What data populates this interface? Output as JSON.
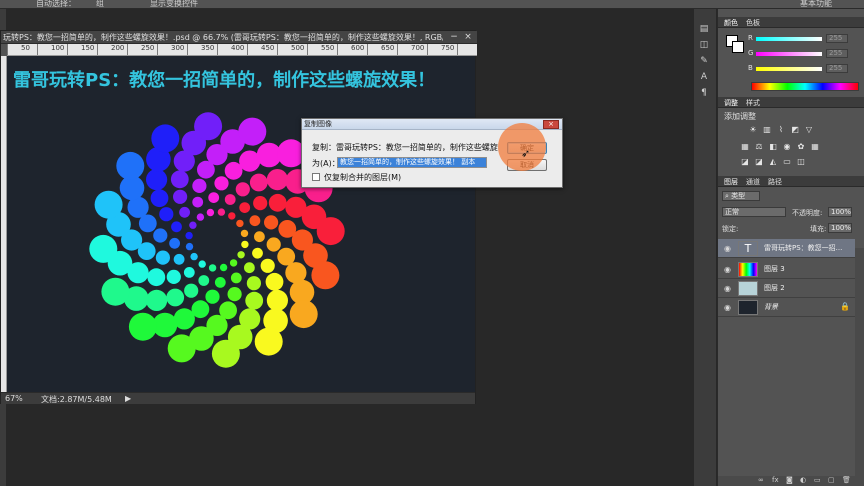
{
  "options_bar": {
    "auto_select": "自动选择：",
    "auto_select_value": "组",
    "show_transform": "显示变换控件",
    "essentials": "基本功能"
  },
  "document": {
    "tab_title": "玩转PS：教您一招简单的，制作这些螺旋效果！.psd @ 66.7% (雷哥玩转PS：教您一招简单的，制作这些螺旋效果！, RGB/...",
    "minimize": "−",
    "close": "×",
    "ruler_marks": [
      "50",
      "100",
      "150",
      "200",
      "250",
      "300",
      "350",
      "400",
      "450",
      "500",
      "550",
      "600",
      "650",
      "700",
      "750"
    ],
    "canvas_title": "雷哥玩转PS：教您一招简单的，制作这些螺旋效果！",
    "zoom": "67%",
    "doc_size": "文档:2.87M/5.48M"
  },
  "dialog": {
    "title": "复制图像",
    "copy_label": "复制：",
    "copy_value": "雷哥玩转PS：教您一招简单的，制作这些螺旋",
    "as_label": "为(A)：",
    "as_value": "教您一招简单的，制作这些螺旋效果！ 副本",
    "merged_checkbox": "仅复制合并的图层(M)",
    "ok": "确定",
    "cancel": "取消",
    "close": "×"
  },
  "color_panel": {
    "tabs": [
      "颜色",
      "色板"
    ],
    "r_label": "R",
    "g_label": "G",
    "b_label": "B",
    "r_value": "255",
    "g_value": "255",
    "b_value": "255"
  },
  "adjust_panel": {
    "tabs": [
      "调整",
      "样式"
    ],
    "heading": "添加调整"
  },
  "layers_panel": {
    "tabs": [
      "图层",
      "通道",
      "路径"
    ],
    "filter_label": "类型",
    "blend_mode": "正常",
    "opacity_label": "不透明度:",
    "opacity_value": "100%",
    "lock_label": "锁定:",
    "fill_label": "填充:",
    "fill_value": "100%",
    "layers": [
      {
        "name": "雷哥玩转PS：教您一招...",
        "type": "text",
        "selected": true
      },
      {
        "name": "图层 3",
        "type": "gradient",
        "selected": false
      },
      {
        "name": "图层 2",
        "type": "pattern",
        "selected": false
      },
      {
        "name": "背景",
        "type": "fill",
        "selected": false
      }
    ],
    "lock_icon": "lock-icon"
  },
  "colors": {
    "canvas_bg": "#1e242d",
    "title_cyan": "#34c4de",
    "highlight": "#f27c3c",
    "selected_layer": "#6f7684"
  }
}
